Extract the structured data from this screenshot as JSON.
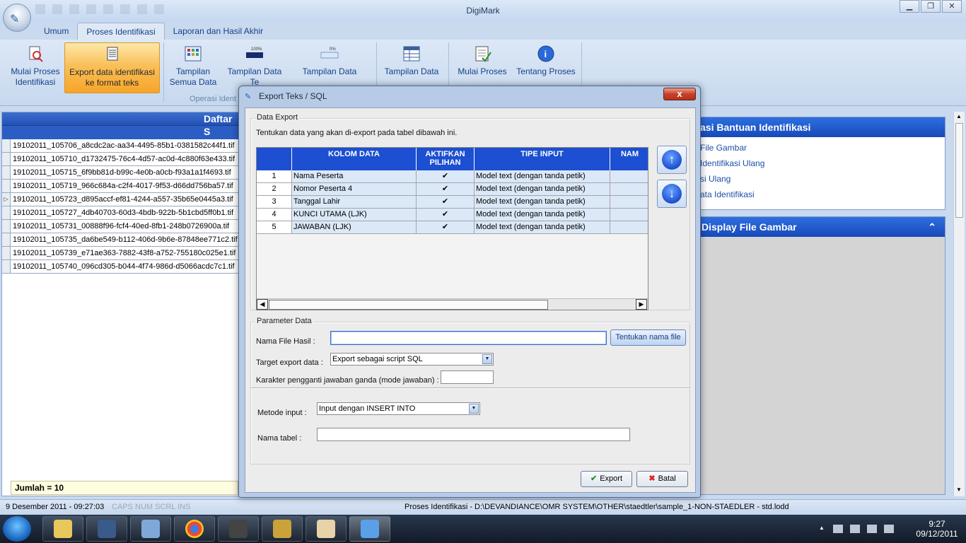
{
  "app": {
    "title": "DigiMark",
    "window_controls": [
      "minimize",
      "restore",
      "close"
    ]
  },
  "ribbon_tabs": [
    {
      "label": "Umum",
      "active": false
    },
    {
      "label": "Proses Identifikasi",
      "active": true
    },
    {
      "label": "Laporan dan Hasil Akhir",
      "active": false
    }
  ],
  "ribbon": {
    "buttons": [
      {
        "line1": "Mulai Proses",
        "line2": "Identifikasi",
        "icon": "scan-document-icon"
      },
      {
        "line1": "Export data identifikasi",
        "line2": "ke format teks",
        "icon": "export-text-icon"
      },
      {
        "line1": "Tampilan",
        "line2": "Semua Data",
        "icon": "grid-view-icon"
      },
      {
        "line1": "Tampilan Data",
        "line2": "Te",
        "icon": "progress-100-icon"
      },
      {
        "line1": "Tampilan Data",
        "line2": "",
        "icon": "progress-0-icon"
      },
      {
        "line1": "Tampilan Data",
        "line2": "",
        "icon": "table-view-icon"
      },
      {
        "line1": "Mulai Proses",
        "line2": "",
        "icon": "checklist-icon"
      },
      {
        "line1": "Tentang Proses",
        "line2": "",
        "icon": "info-icon"
      }
    ],
    "group_label": "Operasi Ident"
  },
  "file_list": {
    "header": "Daftar S",
    "files": [
      "19102011_105706_a8cdc2ac-aa34-4495-85b1-0381582c44f1.tif",
      "19102011_105710_d1732475-76c4-4d57-ac0d-4c880f63e433.tif",
      "19102011_105715_6f9bb81d-b99c-4e0b-a0cb-f93a1a1f4693.tif",
      "19102011_105719_966c684a-c2f4-4017-9f53-d66dd756ba57.tif",
      "19102011_105723_d895accf-ef81-4244-a557-35b65e0445a3.tif",
      "19102011_105727_4db40703-60d3-4bdb-922b-5b1cbd5ff0b1.tif",
      "19102011_105731_00888f96-fcf4-40ed-8fb1-248b0726900a.tif",
      "19102011_105735_da6be549-b112-406d-9b6e-87848ee771c2.tif",
      "19102011_105739_e71ae363-7882-43f8-a752-755180c025e1.tif",
      "19102011_105740_096cd305-b044-4f74-986d-d5066acdc7c1.tif"
    ],
    "current_index": 4,
    "footer": "Jumlah = 10"
  },
  "right_panel": {
    "bantuan_title": "asi Bantuan Identifikasi",
    "links": [
      "File Gambar",
      "Identifikasi Ulang",
      "si Ulang",
      "ata Identifikasi"
    ],
    "display_title": "Display File Gambar",
    "collapse_glyph": "⌃"
  },
  "dialog": {
    "title": "Export Teks / SQL",
    "close_glyph": "x",
    "data_export": {
      "legend": "Data Export",
      "instruction": "Tentukan data yang akan di-export pada tabel dibawah ini.",
      "columns": [
        "",
        "KOLOM DATA",
        "AKTIFKAN PILIHAN",
        "TIPE INPUT",
        "NAM"
      ],
      "rows": [
        {
          "no": "1",
          "kolom": "Nama Peserta",
          "aktif": "✔",
          "tipe": "Model text (dengan tanda petik)"
        },
        {
          "no": "2",
          "kolom": "Nomor Peserta 4",
          "aktif": "✔",
          "tipe": "Model text (dengan tanda petik)"
        },
        {
          "no": "3",
          "kolom": "Tanggal Lahir",
          "aktif": "✔",
          "tipe": "Model text (dengan tanda petik)"
        },
        {
          "no": "4",
          "kolom": "KUNCI UTAMA (LJK)",
          "aktif": "✔",
          "tipe": "Model text (dengan tanda petik)"
        },
        {
          "no": "5",
          "kolom": "JAWABAN (LJK)",
          "aktif": "✔",
          "tipe": "Model text (dengan tanda petik)"
        }
      ]
    },
    "parameter": {
      "legend": "Parameter Data",
      "nama_file_label": "Nama File Hasil :",
      "nama_file_value": "",
      "tentukan_button": "Tentukan nama file",
      "target_label": "Target export data :",
      "target_value": "Export sebagai script SQL",
      "karakter_label": "Karakter pengganti jawaban ganda (mode jawaban) :",
      "karakter_value": "",
      "metode_label": "Metode input :",
      "metode_value": "Input dengan INSERT INTO",
      "nama_tabel_label": "Nama tabel :",
      "nama_tabel_value": ""
    },
    "export_button": "Export",
    "batal_button": "Batal"
  },
  "statusbar": {
    "date": "9 Desember 2011 - 09:27:03",
    "keys": "CAPS   NUM   SCRL   INS",
    "path": "Proses Identifikasi - D:\\DEVANDIANCE\\OMR SYSTEM\\OTHER\\staedtler\\sample_1-NON-STAEDLER - std.lodd"
  },
  "taskbar": {
    "apps": [
      "explorer",
      "media-center",
      "remote-desktop",
      "chrome",
      "app-5",
      "app-6",
      "paint",
      "digimark"
    ],
    "time": "9:27",
    "date": "09/12/2011"
  },
  "colors": {
    "accent": "#1c4fd1",
    "ribbon_active": "#f9c05a"
  }
}
